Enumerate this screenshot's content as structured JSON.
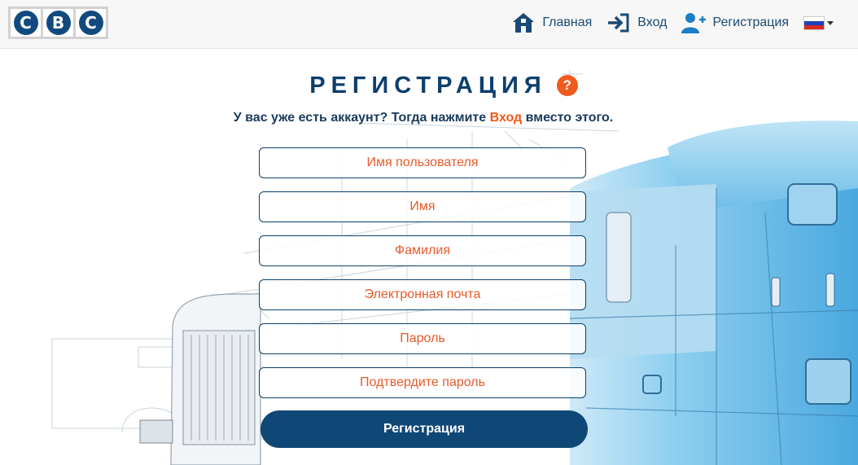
{
  "header": {
    "logo_letters": [
      "C",
      "B",
      "C"
    ],
    "nav": {
      "home": "Главная",
      "login": "Вход",
      "register": "Регистрация"
    },
    "language": {
      "current": "ru",
      "flag_colors": [
        "#ffffff",
        "#1c3fbd",
        "#d52b1e"
      ]
    }
  },
  "page": {
    "title": "РЕГИСТРАЦИЯ",
    "help_icon": "?",
    "subtitle_before": "У вас уже есть аккаунт? Тогда нажмите ",
    "subtitle_link": "Вход",
    "subtitle_after": " вместо этого."
  },
  "form": {
    "username": {
      "placeholder": "Имя пользователя",
      "value": ""
    },
    "first_name": {
      "placeholder": "Имя",
      "value": ""
    },
    "last_name": {
      "placeholder": "Фамилия",
      "value": ""
    },
    "email": {
      "placeholder": "Электронная почта",
      "value": ""
    },
    "password": {
      "placeholder": "Пароль",
      "value": ""
    },
    "confirm_password": {
      "placeholder": "Подтвердите пароль",
      "value": ""
    },
    "submit_label": "Регистрация"
  },
  "colors": {
    "brand": "#0f4877",
    "accent": "#f05a1e"
  },
  "icons": {
    "home": "house-icon",
    "login": "sign-in-icon",
    "register": "user-plus-icon",
    "help": "question-circle-icon"
  }
}
